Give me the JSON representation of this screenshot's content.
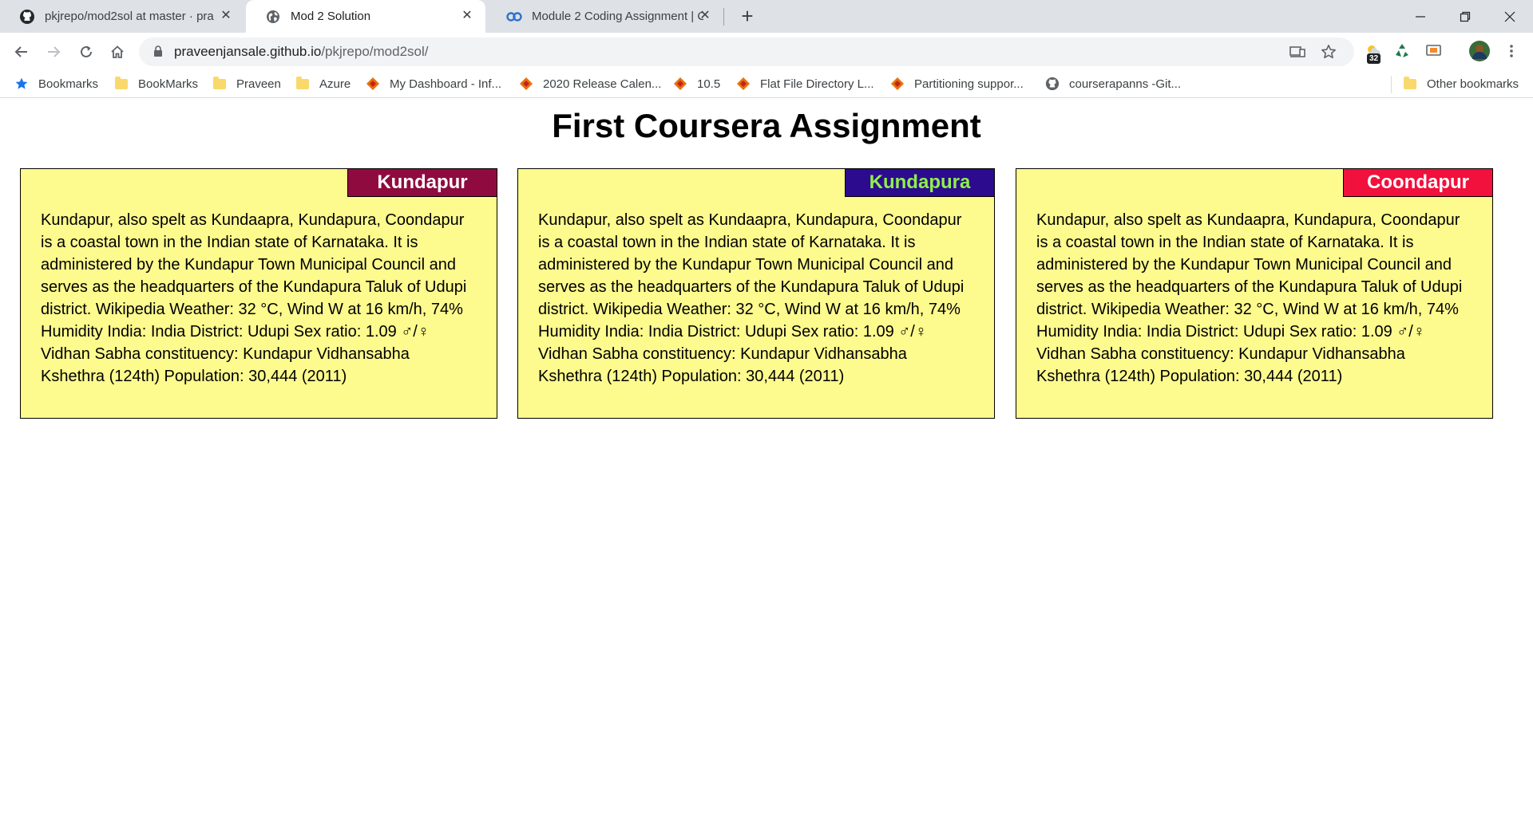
{
  "browser": {
    "tabs": [
      {
        "title": "pkjrepo/mod2sol at master · pra",
        "favicon": "github-icon",
        "active": false
      },
      {
        "title": "Mod 2 Solution",
        "favicon": "globe-icon",
        "active": true
      },
      {
        "title": "Module 2 Coding Assignment | C",
        "favicon": "coursera-icon",
        "active": false
      }
    ],
    "new_tab_label": "+",
    "url": {
      "host": "praveenjansale.github.io",
      "path": "/pkjrepo/mod2sol/"
    },
    "extension_badge": "32",
    "bookmarks": [
      {
        "label": "Bookmarks",
        "icon": "star-icon"
      },
      {
        "label": "BookMarks",
        "icon": "folder-icon"
      },
      {
        "label": "Praveen",
        "icon": "folder-icon"
      },
      {
        "label": "Azure",
        "icon": "folder-icon"
      },
      {
        "label": "My Dashboard - Inf...",
        "icon": "diamond-icon"
      },
      {
        "label": "2020 Release Calen...",
        "icon": "diamond-icon"
      },
      {
        "label": "10.5",
        "icon": "diamond-icon"
      },
      {
        "label": "Flat File Directory L...",
        "icon": "diamond-icon"
      },
      {
        "label": "Partitioning suppor...",
        "icon": "diamond-icon"
      },
      {
        "label": "courserapanns -Git...",
        "icon": "github-icon"
      }
    ],
    "other_bookmarks": "Other bookmarks"
  },
  "page": {
    "title": "First Coursera Assignment",
    "cards": [
      {
        "title": "Kundapur",
        "title_bg": "#8f0b3f",
        "title_color": "#ffffff",
        "text": "Kundapur, also spelt as Kundaapra, Kundapura, Coondapur is a coastal town in the Indian state of Karnataka. It is administered by the Kundapur Town Municipal Council and serves as the headquarters of the Kundapura Taluk of Udupi district. Wikipedia Weather: 32 °C, Wind W at 16 km/h, 74% Humidity India: India District: Udupi Sex ratio: 1.09 ♂/♀ Vidhan Sabha constituency: Kundapur Vidhansabha Kshethra (124th) Population: 30,444 (2011)"
      },
      {
        "title": "Kundapura",
        "title_bg": "#2c0b8f",
        "title_color": "#8ff04a",
        "text": "Kundapur, also spelt as Kundaapra, Kundapura, Coondapur is a coastal town in the Indian state of Karnataka. It is administered by the Kundapur Town Municipal Council and serves as the headquarters of the Kundapura Taluk of Udupi district. Wikipedia Weather: 32 °C, Wind W at 16 km/h, 74% Humidity India: India District: Udupi Sex ratio: 1.09 ♂/♀ Vidhan Sabha constituency: Kundapur Vidhansabha Kshethra (124th) Population: 30,444 (2011)"
      },
      {
        "title": "Coondapur",
        "title_bg": "#f2103c",
        "title_color": "#ffffff",
        "text": "Kundapur, also spelt as Kundaapra, Kundapura, Coondapur is a coastal town in the Indian state of Karnataka. It is administered by the Kundapur Town Municipal Council and serves as the headquarters of the Kundapura Taluk of Udupi district. Wikipedia Weather: 32 °C, Wind W at 16 km/h, 74% Humidity India: India District: Udupi Sex ratio: 1.09 ♂/♀ Vidhan Sabha constituency: Kundapur Vidhansabha Kshethra (124th) Population: 30,444 (2011)"
      }
    ]
  }
}
